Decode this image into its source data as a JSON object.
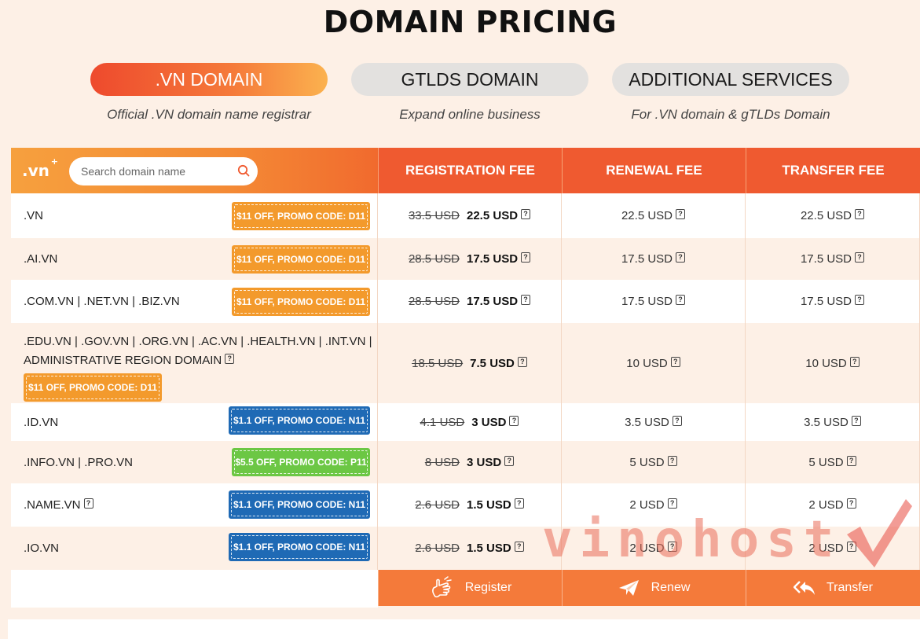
{
  "page_title": "DOMAIN PRICING",
  "tabs": [
    {
      "label": ".VN DOMAIN",
      "subtitle": "Official .VN domain name registrar",
      "active": true
    },
    {
      "label": "GTLDS DOMAIN",
      "subtitle": "Expand online business",
      "active": false
    },
    {
      "label": "ADDITIONAL SERVICES",
      "subtitle": "For .VN domain & gTLDs Domain",
      "active": false
    }
  ],
  "table_header": {
    "logo": ".vn",
    "search_placeholder": "Search domain name",
    "registration_fee": "REGISTRATION FEE",
    "renewal_fee": "RENEWAL FEE",
    "transfer_fee": "TRANSFER FEE"
  },
  "rows": [
    {
      "domain": ".VN",
      "promo": "$11 OFF, PROMO CODE: D11",
      "promo_color": "orange",
      "reg_old": "33.5 USD",
      "reg_new": "22.5 USD",
      "renewal": "22.5 USD",
      "transfer": "22.5 USD"
    },
    {
      "domain": ".AI.VN",
      "promo": "$11 OFF, PROMO CODE: D11",
      "promo_color": "orange",
      "reg_old": "28.5 USD",
      "reg_new": "17.5 USD",
      "renewal": "17.5 USD",
      "transfer": "17.5 USD"
    },
    {
      "domain": ".COM.VN | .NET.VN | .BIZ.VN",
      "promo": "$11 OFF, PROMO CODE: D11",
      "promo_color": "orange",
      "reg_old": "28.5 USD",
      "reg_new": "17.5 USD",
      "renewal": "17.5 USD",
      "transfer": "17.5 USD"
    },
    {
      "domain_line1": ".EDU.VN | .GOV.VN | .ORG.VN | .AC.VN | .HEALTH.VN | .INT.VN |",
      "domain_line2": "ADMINISTRATIVE REGION DOMAIN",
      "promo": "$11 OFF, PROMO CODE: D11",
      "promo_color": "orange",
      "reg_old": "18.5 USD",
      "reg_new": "7.5 USD",
      "renewal": "10 USD",
      "transfer": "10 USD"
    },
    {
      "domain": ".ID.VN",
      "promo": "$1.1 OFF, PROMO CODE: N11",
      "promo_color": "blue",
      "reg_old": "4.1 USD",
      "reg_new": "3 USD",
      "renewal": "3.5 USD",
      "transfer": "3.5 USD"
    },
    {
      "domain": ".INFO.VN | .PRO.VN",
      "promo": "$5.5 OFF, PROMO CODE: P11",
      "promo_color": "green",
      "reg_old": "8 USD",
      "reg_new": "3 USD",
      "renewal": "5 USD",
      "transfer": "5 USD"
    },
    {
      "domain": ".NAME.VN",
      "promo": "$1.1 OFF, PROMO CODE: N11",
      "promo_color": "blue",
      "reg_old": "2.6 USD",
      "reg_new": "1.5 USD",
      "renewal": "2 USD",
      "transfer": "2 USD"
    },
    {
      "domain": ".IO.VN",
      "promo": "$1.1 OFF, PROMO CODE: N11",
      "promo_color": "blue",
      "reg_old": "2.6 USD",
      "reg_new": "1.5 USD",
      "renewal": "2 USD",
      "transfer": "2 USD"
    }
  ],
  "actions": {
    "register": "Register",
    "renew": "Renew",
    "transfer": "Transfer"
  },
  "watermark": "vinohost",
  "colors": {
    "accent": "#ef5a30",
    "promo_orange": "#f39a2c",
    "promo_blue": "#1f6ab5",
    "promo_green": "#6cc744",
    "background": "#fdf0e6"
  }
}
